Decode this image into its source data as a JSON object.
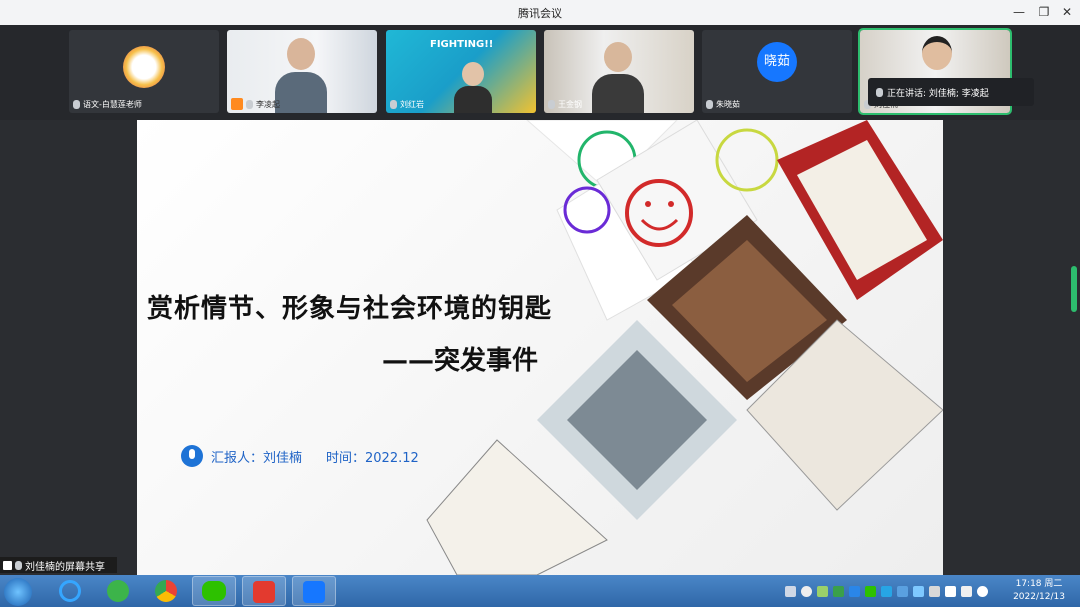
{
  "window": {
    "title": "腾讯会议",
    "min": "—",
    "restore": "❐",
    "close": "✕"
  },
  "participants": [
    {
      "name": "语文-白慧莲老师"
    },
    {
      "name": "李凌起"
    },
    {
      "name": "刘红岩"
    },
    {
      "name": "王金钢"
    },
    {
      "name": "朱晓茹",
      "avatar_text": "晓茹"
    },
    {
      "name": "刘佳楠"
    }
  ],
  "speaking": {
    "text": "正在讲话: 刘佳楠; 李凌起"
  },
  "slide": {
    "title": "赏析情节、形象与社会环境的钥匙",
    "subtitle": "——突发事件",
    "reporter": "汇报人：刘佳楠",
    "time": "时间：2022.12",
    "poster_text": "FIGHTING!!"
  },
  "share_bar": {
    "text": "刘佳楠的屏幕共享"
  },
  "taskbar": {
    "time": "17:18 周二",
    "date": "2022/12/13"
  },
  "colors": {
    "accent_green": "#2dbd6e",
    "avatar_blue": "#1677ff",
    "taskbar": "#3a78bd"
  }
}
